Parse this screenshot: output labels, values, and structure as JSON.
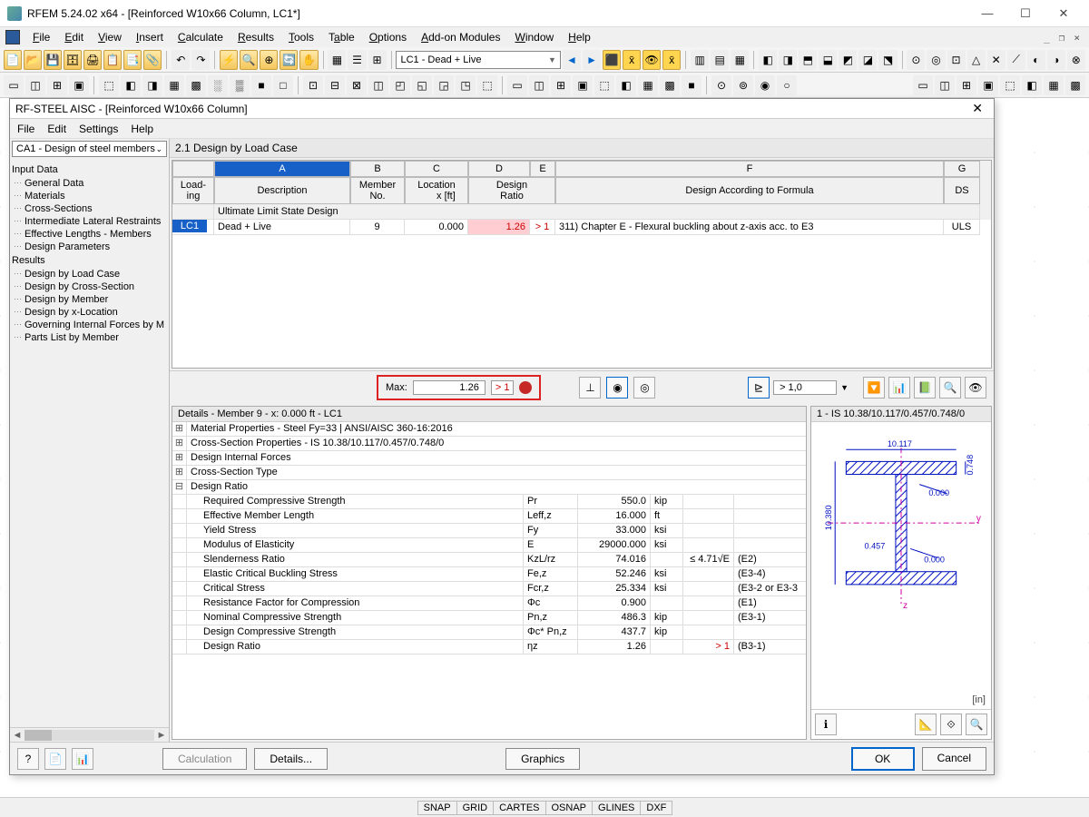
{
  "app": {
    "title": "RFEM 5.24.02 x64 - [Reinforced W10x66 Column, LC1*]",
    "menus": [
      "File",
      "Edit",
      "View",
      "Insert",
      "Calculate",
      "Results",
      "Tools",
      "Table",
      "Options",
      "Add-on Modules",
      "Window",
      "Help"
    ],
    "combo": "LC1 - Dead + Live"
  },
  "statusbar": [
    "SNAP",
    "GRID",
    "CARTES",
    "OSNAP",
    "GLINES",
    "DXF"
  ],
  "dialog": {
    "title": "RF-STEEL AISC - [Reinforced W10x66 Column]",
    "menus": [
      "File",
      "Edit",
      "Settings",
      "Help"
    ],
    "case_combo": "CA1 - Design of steel members",
    "tree": {
      "input": "Input Data",
      "input_items": [
        "General Data",
        "Materials",
        "Cross-Sections",
        "Intermediate Lateral Restraints",
        "Effective Lengths - Members",
        "Design Parameters"
      ],
      "results": "Results",
      "results_items": [
        "Design by Load Case",
        "Design by Cross-Section",
        "Design by Member",
        "Design by x-Location",
        "Governing Internal Forces by M",
        "Parts List by Member"
      ]
    },
    "panel_title": "2.1 Design by Load Case",
    "grid": {
      "col_letters": [
        "A",
        "B",
        "C",
        "D",
        "E",
        "F",
        "G"
      ],
      "loading_hdr": "Load-\ning",
      "desc_hdr": "Description",
      "member_hdr": "Member\nNo.",
      "loc_hdr": "Location\nx [ft]",
      "design_hdr": "Design\nRatio",
      "formula_hdr": "Design According to Formula",
      "ds_hdr": "DS",
      "group": "Ultimate Limit State Design",
      "row": {
        "lc": "LC1",
        "desc": "Dead + Live",
        "member": "9",
        "loc": "0.000",
        "ratio": "1.26",
        "cmp": "> 1",
        "formula": "311) Chapter E - Flexural buckling about z-axis acc. to E3",
        "ds": "ULS"
      }
    },
    "max": {
      "label": "Max:",
      "value": "1.26",
      "cmp": "> 1"
    },
    "filter_combo": "> 1,0",
    "details_hdr": "Details - Member 9 - x: 0.000 ft - LC1",
    "details_groups": [
      "Material Properties - Steel Fy=33 | ANSI/AISC 360-16:2016",
      "Cross-Section Properties  -  IS 10.38/10.117/0.457/0.748/0",
      "Design Internal Forces",
      "Cross-Section Type",
      "Design Ratio"
    ],
    "details_rows": [
      {
        "lbl": "Required Compressive Strength",
        "sym": "Pr",
        "val": "550.0",
        "unit": "kip",
        "chk": "",
        "ref": ""
      },
      {
        "lbl": "Effective Member Length",
        "sym": "Leff,z",
        "val": "16.000",
        "unit": "ft",
        "chk": "",
        "ref": ""
      },
      {
        "lbl": "Yield Stress",
        "sym": "Fy",
        "val": "33.000",
        "unit": "ksi",
        "chk": "",
        "ref": ""
      },
      {
        "lbl": "Modulus of Elasticity",
        "sym": "E",
        "val": "29000.000",
        "unit": "ksi",
        "chk": "",
        "ref": ""
      },
      {
        "lbl": "Slenderness Ratio",
        "sym": "KzL/rz",
        "val": "74.016",
        "unit": "",
        "chk": "≤ 4.71√E",
        "ref": "(E2)"
      },
      {
        "lbl": "Elastic Critical Buckling Stress",
        "sym": "Fe,z",
        "val": "52.246",
        "unit": "ksi",
        "chk": "",
        "ref": "(E3-4)"
      },
      {
        "lbl": "Critical Stress",
        "sym": "Fcr,z",
        "val": "25.334",
        "unit": "ksi",
        "chk": "",
        "ref": "(E3-2 or E3-3"
      },
      {
        "lbl": "Resistance Factor for Compression",
        "sym": "Φc",
        "val": "0.900",
        "unit": "",
        "chk": "",
        "ref": "(E1)"
      },
      {
        "lbl": "Nominal Compressive Strength",
        "sym": "Pn,z",
        "val": "486.3",
        "unit": "kip",
        "chk": "",
        "ref": "(E3-1)"
      },
      {
        "lbl": "Design Compressive Strength",
        "sym": "Φc* Pn,z",
        "val": "437.7",
        "unit": "kip",
        "chk": "",
        "ref": ""
      },
      {
        "lbl": "Design Ratio",
        "sym": "ηz",
        "val": "1.26",
        "unit": "",
        "chk": "> 1",
        "ref": "(B3-1)",
        "red": true
      }
    ],
    "section_label": "1 - IS 10.38/10.117/0.457/0.748/0",
    "section_dims": {
      "bf": "10.117",
      "tf": "0.748",
      "d": "10.380",
      "tw": "0.457",
      "zero1": "0.000",
      "zero2": "0.000"
    },
    "section_unit": "[in]",
    "footer": {
      "calc": "Calculation",
      "details": "Details...",
      "graphics": "Graphics",
      "ok": "OK",
      "cancel": "Cancel"
    }
  }
}
